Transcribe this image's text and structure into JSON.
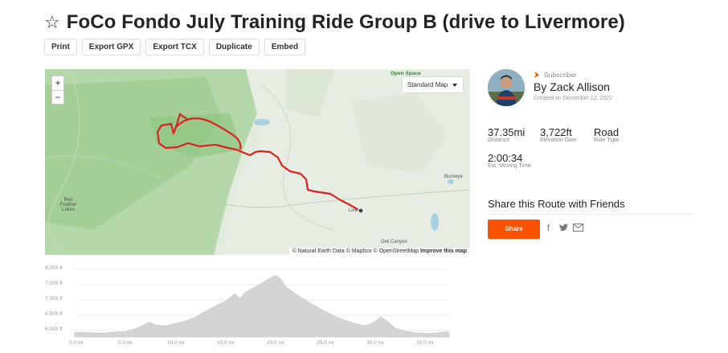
{
  "title": "FoCo Fondo July Training Ride Group B (drive to Livermore)",
  "toolbar": [
    "Print",
    "Export GPX",
    "Export TCX",
    "Duplicate",
    "Embed"
  ],
  "map": {
    "zoom_in": "+",
    "zoom_out": "−",
    "style_select": "Standard Map",
    "open_space": "Open Space",
    "labels": {
      "red_feather": "Red Feather Lakes",
      "buckeye": "Buckeye",
      "live": "Live",
      "owl_canyon": "Owl Canyon"
    },
    "attribution": "© Natural Earth Data © Mapbox © OpenStreetMap",
    "improve": "Improve this map",
    "route_color": "#e02020"
  },
  "elevation": {
    "y_ticks": [
      "8,000 ft",
      "7,500 ft",
      "7,000 ft",
      "6,500 ft",
      "6,000 ft"
    ],
    "x_ticks": [
      "0.0 mi",
      "5.0 mi",
      "10.0 mi",
      "15.0 mi",
      "20.0 mi",
      "25.0 mi",
      "30.0 mi",
      "35.0 mi"
    ],
    "profile": [
      [
        0,
        5940
      ],
      [
        1,
        5930
      ],
      [
        2,
        5920
      ],
      [
        3,
        5910
      ],
      [
        4,
        5950
      ],
      [
        5,
        5960
      ],
      [
        6,
        6050
      ],
      [
        7,
        6200
      ],
      [
        7.5,
        6280
      ],
      [
        8,
        6180
      ],
      [
        9,
        6150
      ],
      [
        10,
        6230
      ],
      [
        11,
        6310
      ],
      [
        12,
        6430
      ],
      [
        13,
        6620
      ],
      [
        14,
        6800
      ],
      [
        15,
        6950
      ],
      [
        16,
        7200
      ],
      [
        16.5,
        7050
      ],
      [
        17,
        7250
      ],
      [
        18,
        7420
      ],
      [
        19,
        7620
      ],
      [
        20,
        7800
      ],
      [
        20.5,
        7710
      ],
      [
        21,
        7450
      ],
      [
        22,
        7200
      ],
      [
        23,
        7000
      ],
      [
        24,
        6800
      ],
      [
        25,
        6620
      ],
      [
        26,
        6460
      ],
      [
        27,
        6330
      ],
      [
        28,
        6230
      ],
      [
        29,
        6150
      ],
      [
        30,
        6300
      ],
      [
        30.5,
        6450
      ],
      [
        31,
        6350
      ],
      [
        32,
        6070
      ],
      [
        33,
        5970
      ],
      [
        34,
        5930
      ],
      [
        35,
        5900
      ],
      [
        36,
        5910
      ],
      [
        37,
        5960
      ],
      [
        37.35,
        5940
      ]
    ],
    "fill": "#d4d4d4",
    "stroke": "#bbbbbb"
  },
  "author": {
    "subscriber": "Subscriber",
    "name": "By Zack Allison",
    "created": "Created on December 12, 2022",
    "accent": "#fc5200"
  },
  "stats": {
    "distance": {
      "value": "37.35mi",
      "label": "Distance"
    },
    "elevation_gain": {
      "value": "3,722ft",
      "label": "Elevation Gain"
    },
    "ride_type": {
      "value": "Road",
      "label": "Ride Type"
    },
    "moving_time": {
      "value": "2:00:34",
      "label": "Est. Moving Time"
    }
  },
  "share": {
    "title": "Share this Route with Friends",
    "button": "Share",
    "icons": [
      "facebook-icon",
      "twitter-icon",
      "email-icon"
    ]
  }
}
